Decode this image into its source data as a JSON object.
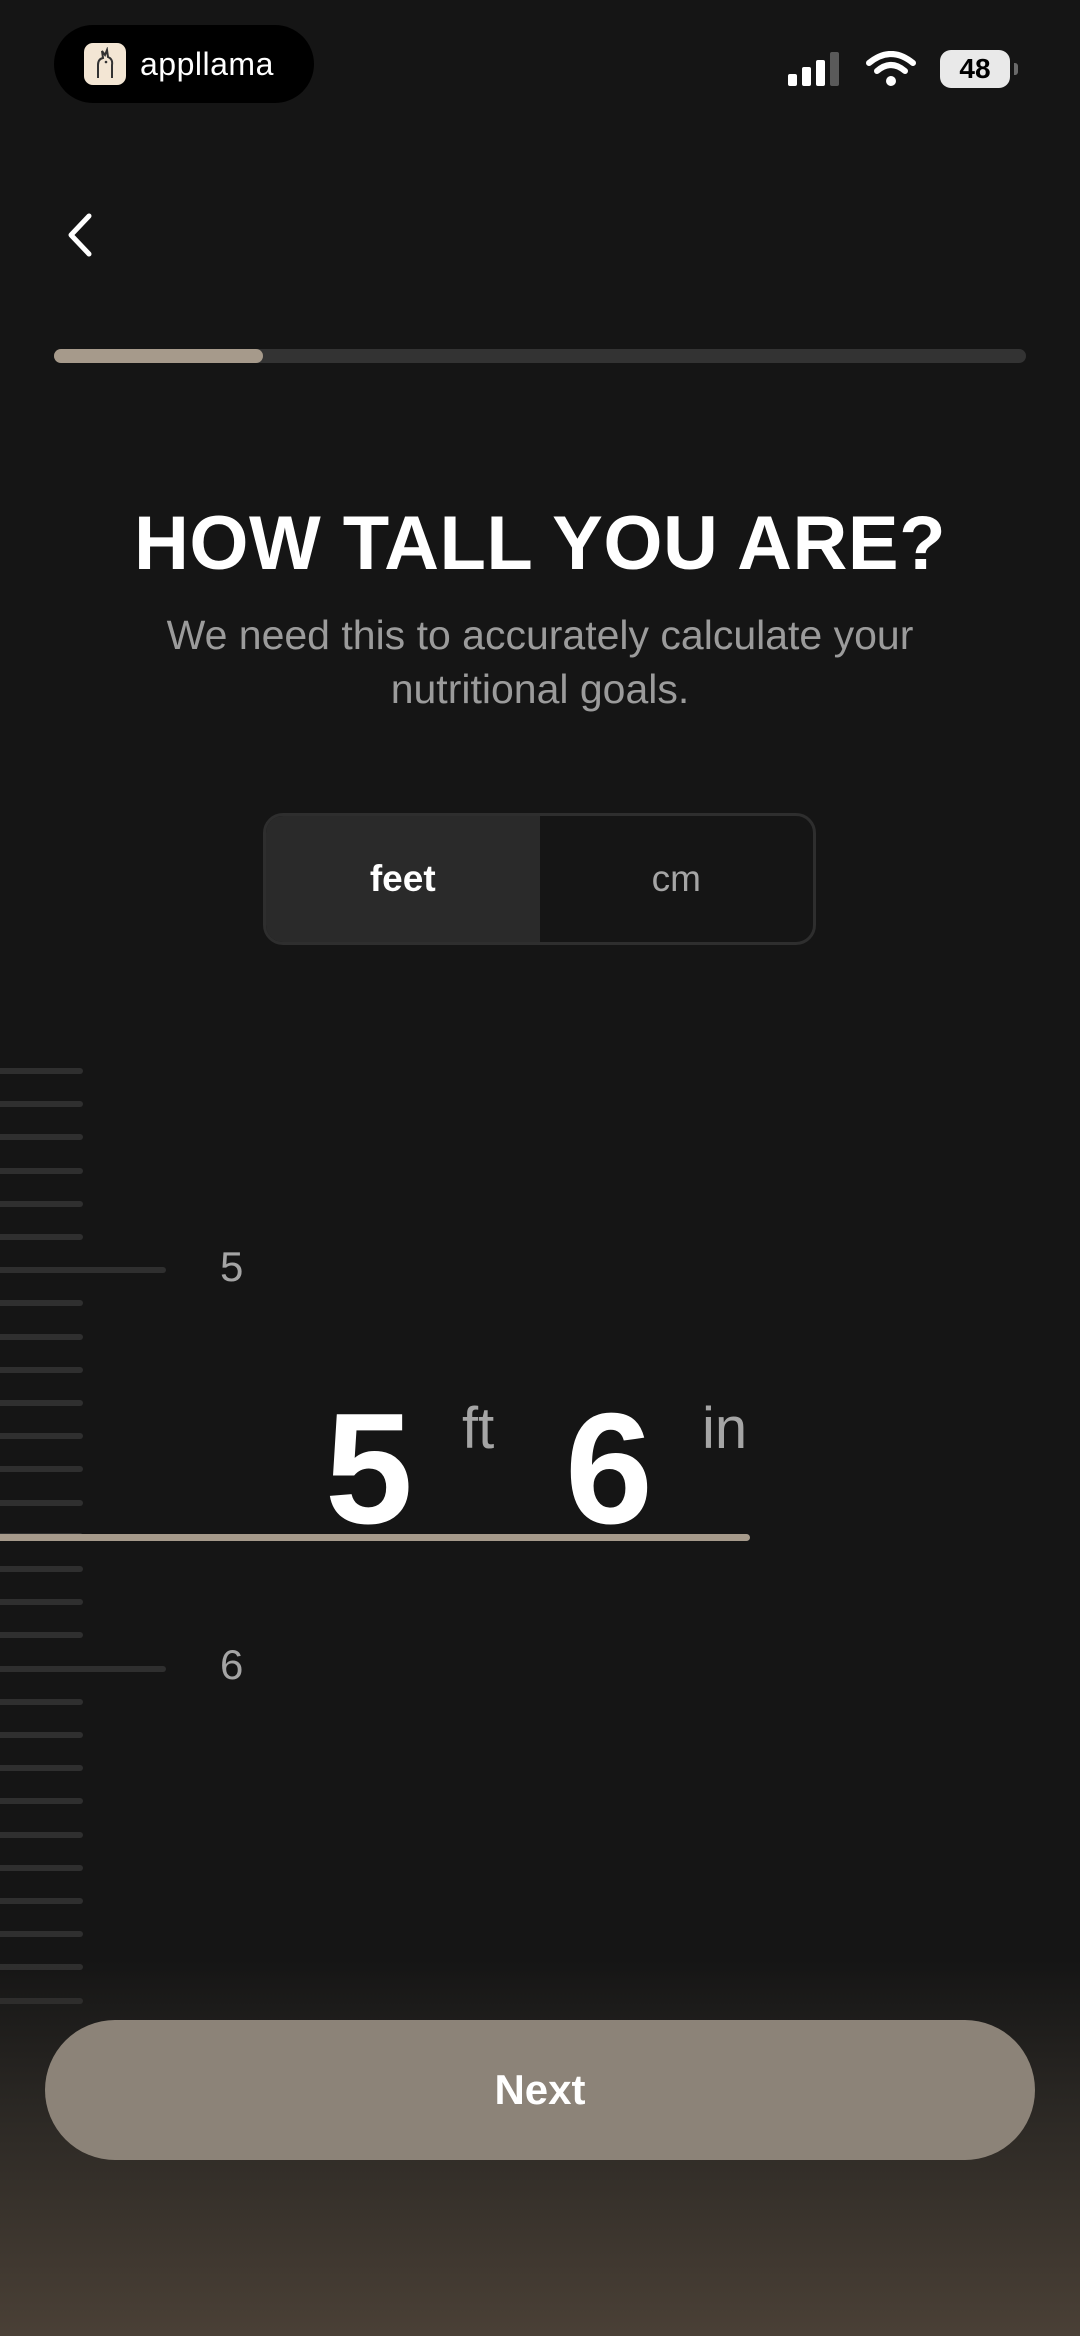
{
  "status_bar": {
    "app_name": "appllama",
    "battery": "48"
  },
  "onboarding": {
    "progress_fraction": 0.215
  },
  "header": {
    "title": "HOW TALL YOU ARE?",
    "subtitle": "We need this to accurately calculate your nutritional goals."
  },
  "unit_toggle": {
    "options": [
      "feet",
      "cm"
    ],
    "selected": "feet"
  },
  "ruler": {
    "labels": [
      "5",
      "6"
    ]
  },
  "height_value": {
    "feet": "5",
    "feet_unit": "ft",
    "inches": "6",
    "inches_unit": "in"
  },
  "next_button": {
    "label": "Next"
  },
  "colors": {
    "background": "#151515",
    "accent": "#a69a8b",
    "button": "#8c8378"
  },
  "icons": {
    "back": "chevron-left-icon",
    "signal": "cellular-signal-icon",
    "wifi": "wifi-icon",
    "battery": "battery-icon",
    "logo": "llama-logo-icon"
  }
}
